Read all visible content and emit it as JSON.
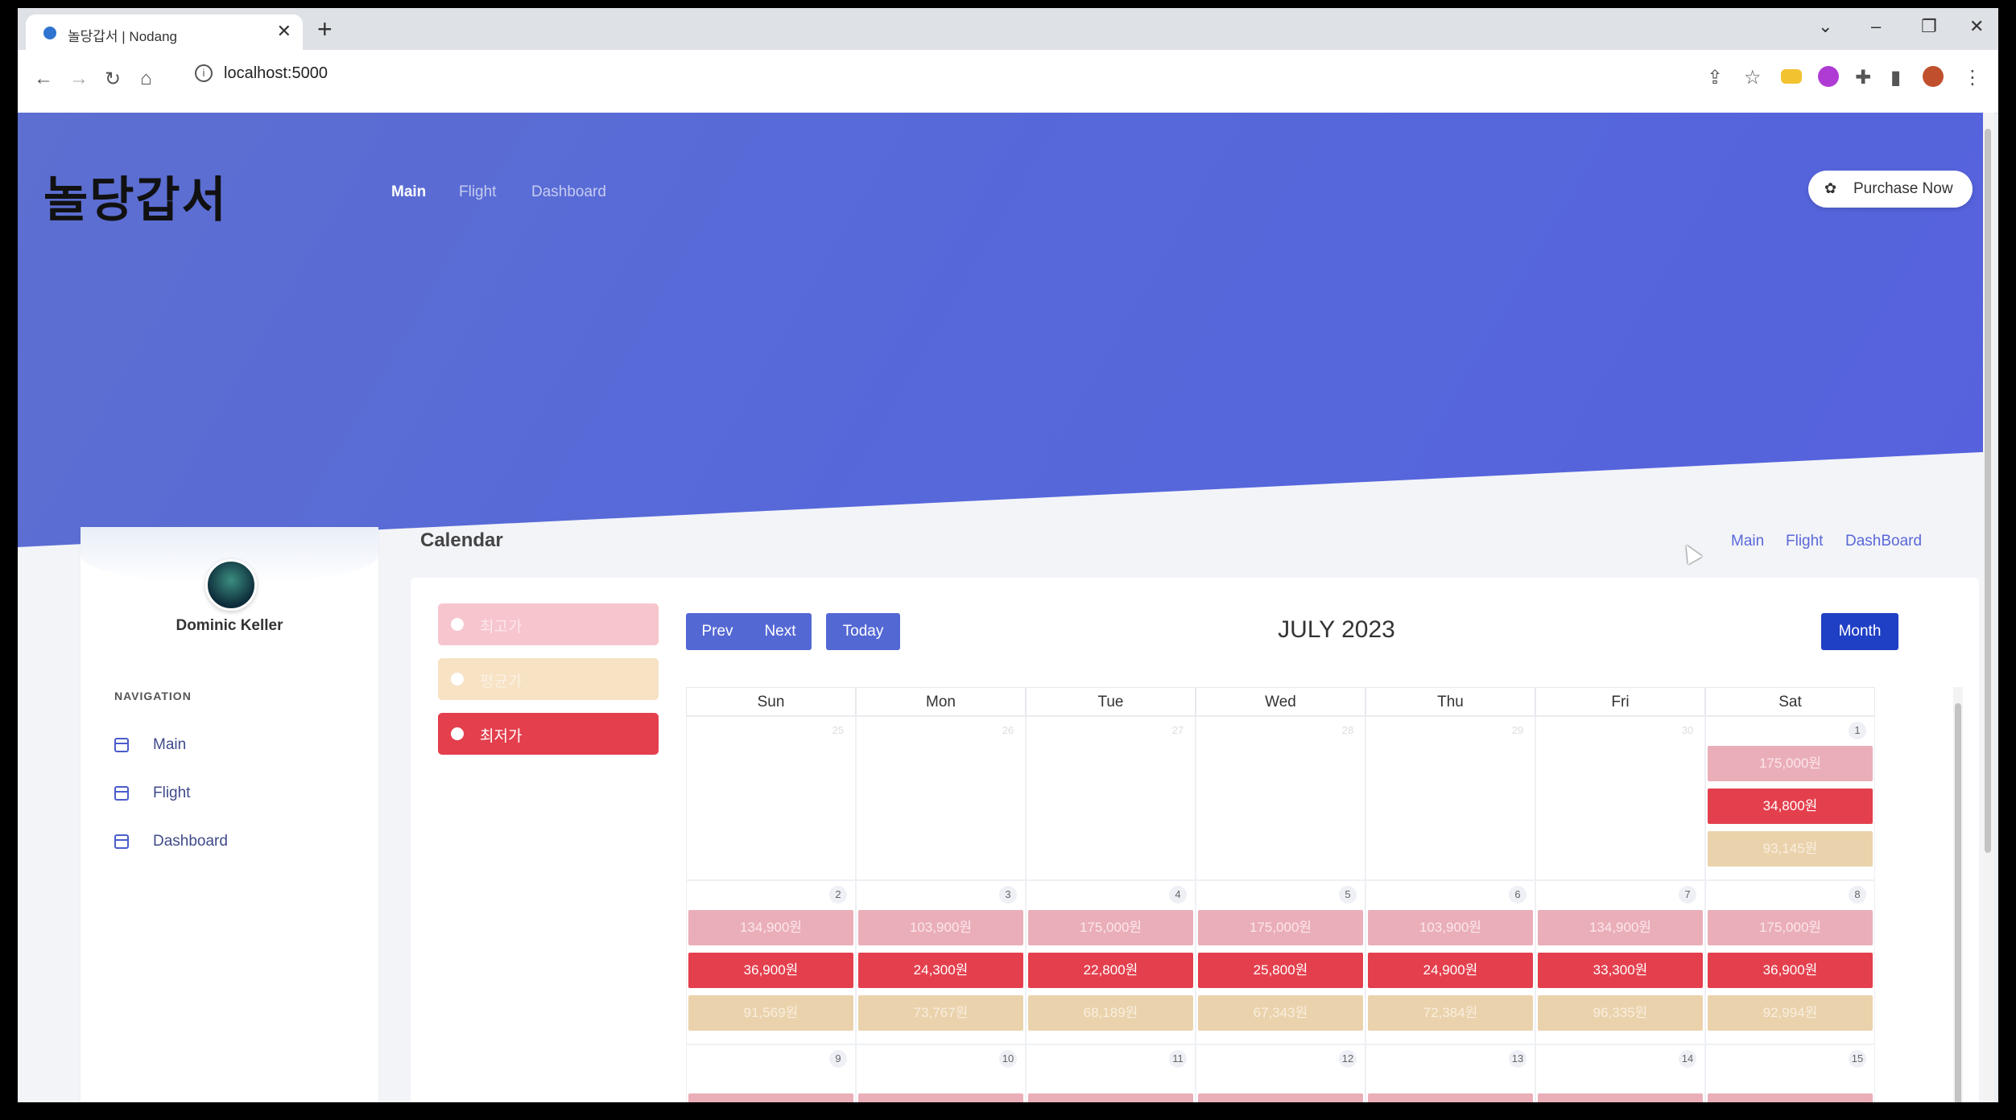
{
  "browser": {
    "tab_title": "놀당갑서 | Nodang",
    "close_glyph": "✕",
    "newtab_glyph": "+",
    "url": "localhost:5000",
    "info_glyph": "i",
    "window_controls": {
      "dropdown": "⌄",
      "minimize": "–",
      "restore": "❐",
      "close": "✕"
    },
    "nav_glyphs": {
      "back": "←",
      "forward": "→",
      "reload": "↻",
      "home": "⌂"
    },
    "toolbar_glyphs": {
      "share": "⇪",
      "bookmark": "☆",
      "extensions": "✚",
      "sidepanel": "▮",
      "menu": "⋮"
    },
    "extension_colors": [
      "#f2c230",
      "#b03bd4",
      "#c0502d"
    ]
  },
  "header": {
    "logo": "놀당갑서",
    "nav": [
      "Main",
      "Flight",
      "Dashboard"
    ],
    "active_nav": "Main",
    "purchase_label": "Purchase Now",
    "purchase_glyph": "✿"
  },
  "sidebar": {
    "user_name": "Dominic Keller",
    "nav_header": "NAVIGATION",
    "items": [
      {
        "label": "Main"
      },
      {
        "label": "Flight"
      },
      {
        "label": "Dashboard"
      }
    ]
  },
  "content": {
    "title": "Calendar",
    "breadcrumbs": [
      "Main",
      "Flight",
      "DashBoard"
    ]
  },
  "calendar": {
    "legend": [
      {
        "label": "최고가",
        "color": "#f7c5cd"
      },
      {
        "label": "평균가",
        "color": "#f7e2c4"
      },
      {
        "label": "최저가",
        "color": "#e43f4d"
      }
    ],
    "buttons": {
      "prev": "Prev",
      "next": "Next",
      "today": "Today",
      "month": "Month"
    },
    "month_label": "JULY 2023",
    "day_headers": [
      "Sun",
      "Mon",
      "Tue",
      "Wed",
      "Thu",
      "Fri",
      "Sat"
    ],
    "week1": {
      "days": [
        "25",
        "26",
        "27",
        "28",
        "29",
        "30",
        "1"
      ],
      "sat_prices": {
        "high": "175,000원",
        "low": "34,800원",
        "avg": "93,145원"
      }
    },
    "week2": {
      "days": [
        "2",
        "3",
        "4",
        "5",
        "6",
        "7",
        "8"
      ],
      "high": [
        "134,900원",
        "103,900원",
        "175,000원",
        "175,000원",
        "103,900원",
        "134,900원",
        "175,000원"
      ],
      "low": [
        "36,900원",
        "24,300원",
        "22,800원",
        "25,800원",
        "24,900원",
        "33,300원",
        "36,900원"
      ],
      "avg": [
        "91,569원",
        "73,767원",
        "68,189원",
        "67,343원",
        "72,384원",
        "96,335원",
        "92,994원"
      ]
    },
    "week3": {
      "days": [
        "9",
        "10",
        "11",
        "12",
        "13",
        "14",
        "15"
      ]
    }
  }
}
